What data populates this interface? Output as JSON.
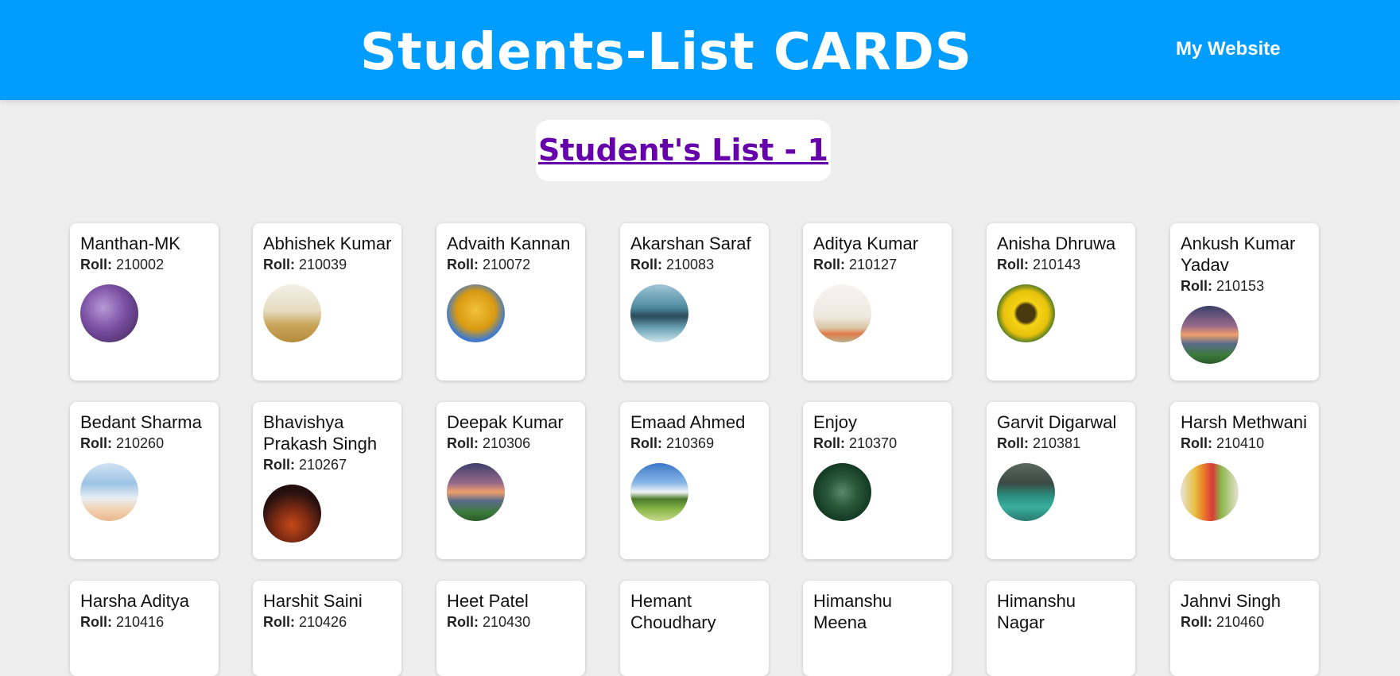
{
  "header": {
    "title": "Students-List CARDS",
    "link": "My Website"
  },
  "list_title": "Student's List - 1",
  "roll_label": "Roll:",
  "colors": {
    "header_bg": "#009dff",
    "page_bg": "#eeeeee",
    "list_title": "#6600aa"
  },
  "students": [
    {
      "name": "Manthan-MK",
      "roll": "210002",
      "image": "purple-lavender-field",
      "avatar_bg": "radial-gradient(circle at 40% 40%, #b89ad6 0%, #7a4fa3 45%, #3b2350 100%)"
    },
    {
      "name": "Abhishek Kumar",
      "roll": "210039",
      "image": "lone-tree-golden-field",
      "avatar_bg": "linear-gradient(180deg, #f2f1e8 0%, #e6dcc0 45%, #c9a65c 70%, #b48b3c 100%)"
    },
    {
      "name": "Advaith Kannan",
      "roll": "210072",
      "image": "yellow-autumn-leaves",
      "avatar_bg": "radial-gradient(circle at 50% 45%, #f0c23a 0%, #d99a12 45%, #3a7ad4 70%, #c98f0f 100%)"
    },
    {
      "name": "Akarshan Saraf",
      "roll": "210083",
      "image": "mountain-lake-reflection",
      "avatar_bg": "linear-gradient(180deg, #9fc6d6 0%, #4f8aa0 40%, #2a4a5a 55%, #6aa3b5 75%, #cfe4ec 100%)"
    },
    {
      "name": "Aditya Kumar",
      "roll": "210127",
      "image": "wildflower-meadow",
      "avatar_bg": "linear-gradient(180deg, #f6f4f0 0%, #efe9e0 55%, #d9c7a6 75%, #e07a4a 85%, #b8b08a 100%)"
    },
    {
      "name": "Anisha Dhruwa",
      "roll": "210143",
      "image": "sunflower",
      "avatar_bg": "radial-gradient(circle at 50% 50%, #4a3a10 0%, #4a3a10 22%, #f4d315 30%, #e8c20c 55%, #2f6a2a 75%, #1e4a1c 100%)"
    },
    {
      "name": "Ankush Kumar Yadav",
      "roll": "210153",
      "image": "sunset-clouds-valley",
      "avatar_bg": "linear-gradient(180deg, #3a3f6a 0%, #9a6a8a 35%, #f0a06a 50%, #5a6a8a 65%, #3c7a3a 85%, #2a5a2a 100%)"
    },
    {
      "name": "Bedant Sharma",
      "roll": "210260",
      "image": "sky-beach-horizon",
      "avatar_bg": "linear-gradient(180deg, #cfe2f2 0%, #9cc3e4 35%, #e8eef4 60%, #f2d2b0 80%, #e8b890 100%)"
    },
    {
      "name": "Bhavishya Prakash Singh",
      "roll": "210267",
      "image": "night-rock-glow",
      "avatar_bg": "radial-gradient(circle at 50% 70%, #c4481a 0%, #7a2a12 35%, #2a1210 65%, #120808 100%)"
    },
    {
      "name": "Deepak Kumar",
      "roll": "210306",
      "image": "sunset-clouds-valley",
      "avatar_bg": "linear-gradient(180deg, #3a3f6a 0%, #9a6a8a 35%, #f0a06a 50%, #5a6a8a 65%, #3c7a3a 85%, #2a5a2a 100%)"
    },
    {
      "name": "Emaad Ahmed",
      "roll": "210369",
      "image": "tree-in-meadow",
      "avatar_bg": "linear-gradient(180deg, #3a78c8 0%, #8cb8e8 35%, #f4f4f4 50%, #4a7a2a 62%, #8ab84a 80%, #c8d88a 100%)"
    },
    {
      "name": "Enjoy",
      "roll": "210370",
      "image": "pine-branches",
      "avatar_bg": "radial-gradient(circle at 50% 50%, #5a8a6a 0%, #2a5a3a 35%, #143a24 70%, #0c2216 100%)"
    },
    {
      "name": "Garvit Digarwal",
      "roll": "210381",
      "image": "mountain-lake-boats",
      "avatar_bg": "linear-gradient(180deg, #5a6a62 0%, #3a4a44 35%, #2a8a7a 55%, #3ab0a0 75%, #2a7a70 100%)"
    },
    {
      "name": "Harsh Methwani",
      "roll": "210410",
      "image": "colorful-leaves",
      "avatar_bg": "linear-gradient(90deg, #e8e2d6 0%, #e8c040 25%, #e87a2a 40%, #d83a3a 55%, #8ab84a 70%, #e8e2d6 100%)"
    }
  ],
  "partial_students": [
    {
      "name": "Harsha Aditya",
      "roll": "210416"
    },
    {
      "name": "Harshit Saini",
      "roll": "210426"
    },
    {
      "name": "Heet Patel",
      "roll": "210430"
    },
    {
      "name": "Hemant Choudhary",
      "roll": ""
    },
    {
      "name": "Himanshu Meena",
      "roll": ""
    },
    {
      "name": "Himanshu Nagar",
      "roll": ""
    },
    {
      "name": "Jahnvi Singh",
      "roll": "210460"
    }
  ]
}
